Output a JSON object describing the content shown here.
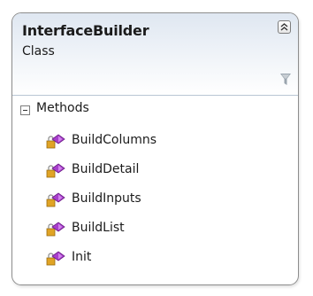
{
  "class_shape": {
    "name": "InterfaceBuilder",
    "kind": "Class",
    "collapse_icon": "double-chevron-up-icon",
    "filter_icon": "funnel-icon"
  },
  "methods_section": {
    "title": "Methods",
    "expander_icon": "minus-box-icon",
    "method_icon": "method-with-lock-icon",
    "items": [
      {
        "name": "BuildColumns"
      },
      {
        "name": "BuildDetail"
      },
      {
        "name": "BuildInputs"
      },
      {
        "name": "BuildList"
      },
      {
        "name": "Init"
      }
    ]
  },
  "colors": {
    "border": "#8d8d8d",
    "header_top": "#dfe7f1",
    "method_purple": "#a83ecc",
    "lock_gold": "#e0a425"
  }
}
